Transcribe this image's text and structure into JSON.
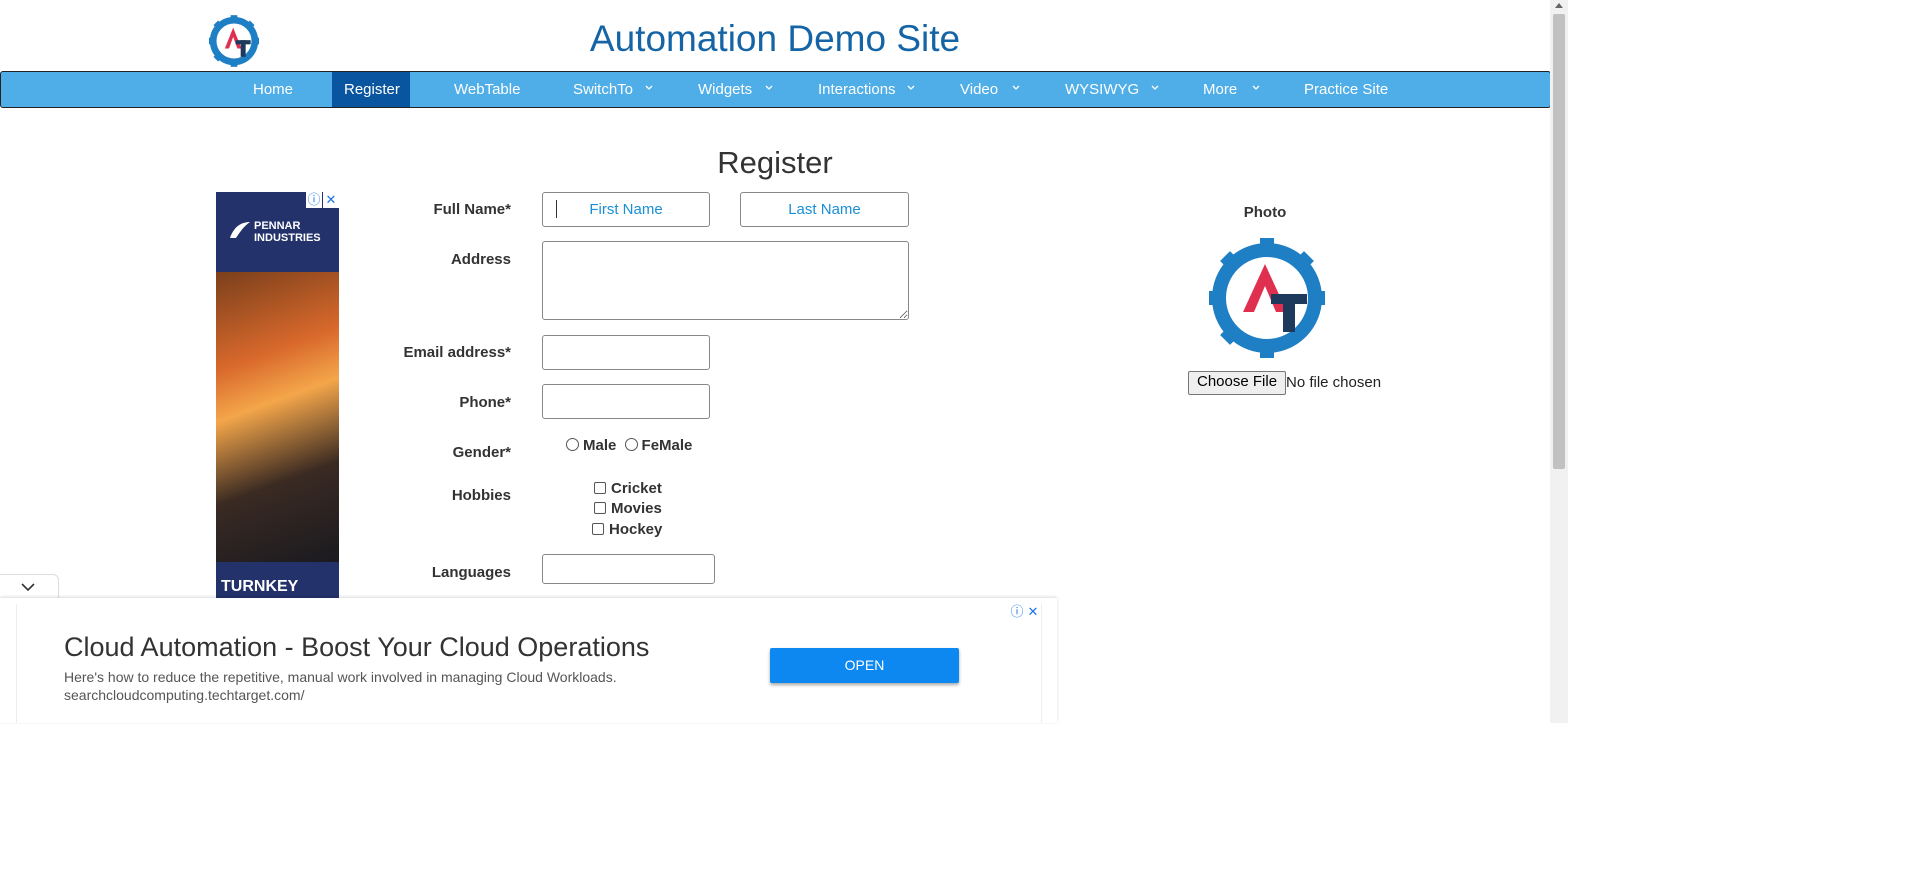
{
  "site": {
    "title": "Automation Demo Site"
  },
  "nav": {
    "items": [
      {
        "label": "Home"
      },
      {
        "label": "Register"
      },
      {
        "label": "WebTable"
      },
      {
        "label": "SwitchTo"
      },
      {
        "label": "Widgets"
      },
      {
        "label": "Interactions"
      },
      {
        "label": "Video"
      },
      {
        "label": "WYSIWYG"
      },
      {
        "label": "More"
      },
      {
        "label": "Practice Site"
      }
    ]
  },
  "form": {
    "title": "Register",
    "full_name_label": "Full Name*",
    "first_name_placeholder": "First Name",
    "last_name_placeholder": "Last Name",
    "address_label": "Address",
    "email_label": "Email address*",
    "phone_label": "Phone*",
    "gender_label": "Gender*",
    "gender_options": [
      "Male",
      "FeMale"
    ],
    "hobbies_label": "Hobbies",
    "hobbies": [
      "Cricket",
      "Movies",
      "Hockey"
    ],
    "languages_label": "Languages"
  },
  "photo": {
    "label": "Photo",
    "choose_file": "Choose File",
    "no_file": "No file chosen"
  },
  "side_ad": {
    "brand_line1": "PENNAR",
    "brand_line2": "INDUSTRIES",
    "tagline": "TURNKEY"
  },
  "bottom_ad": {
    "title": "Cloud Automation - Boost Your Cloud Operations",
    "description": "Here's how to reduce the repetitive, manual work involved in managing Cloud Workloads.",
    "url": "searchcloudcomputing.techtarget.com/",
    "button": "OPEN"
  },
  "icons": {
    "logo": "automation-testing-gear-logo",
    "chevron": "chevron-down-icon",
    "ad_info": "info-icon",
    "ad_close": "close-icon"
  },
  "colors": {
    "nav_bg": "#4faee8",
    "nav_active": "#0a55a0",
    "title_blue": "#1565a6",
    "placeholder_blue": "#1a8fd6",
    "open_button": "#0d88f0"
  }
}
